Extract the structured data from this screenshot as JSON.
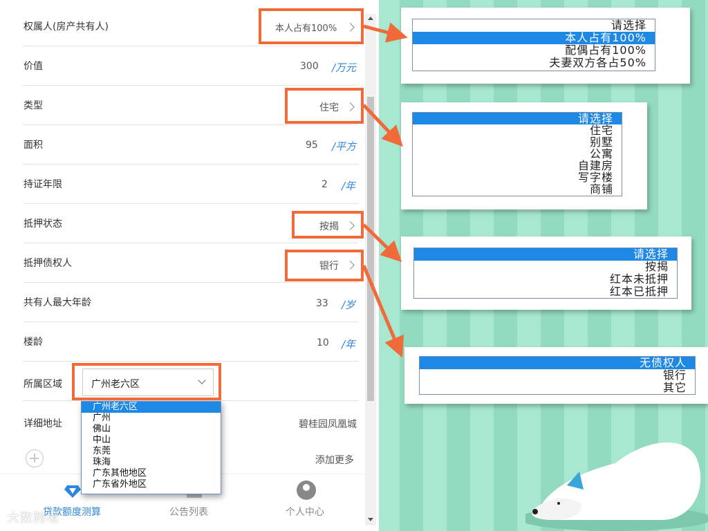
{
  "form": {
    "rows": [
      {
        "label": "权属人(房产共有人)",
        "value": "本人占有100%",
        "unit": "",
        "type": "select"
      },
      {
        "label": "价值",
        "value": "300",
        "unit": "/万元",
        "type": "input"
      },
      {
        "label": "类型",
        "value": "住宅",
        "unit": "",
        "type": "select"
      },
      {
        "label": "面积",
        "value": "95",
        "unit": "/平方",
        "type": "input"
      },
      {
        "label": "持证年限",
        "value": "2",
        "unit": "/年",
        "type": "input"
      },
      {
        "label": "抵押状态",
        "value": "按揭",
        "unit": "",
        "type": "select"
      },
      {
        "label": "抵押债权人",
        "value": "银行",
        "unit": "",
        "type": "select"
      },
      {
        "label": "共有人最大年龄",
        "value": "33",
        "unit": "/岁",
        "type": "input"
      },
      {
        "label": "楼龄",
        "value": "10",
        "unit": "/年",
        "type": "input"
      },
      {
        "label": "所属区域",
        "value": "广州老六区",
        "unit": "",
        "type": "dropdown"
      },
      {
        "label": "详细地址",
        "value": "碧桂园凤凰城",
        "unit": "",
        "type": "input"
      }
    ],
    "region_options": [
      "广州老六区",
      "广州",
      "佛山",
      "中山",
      "东莞",
      "珠海",
      "广东其他地区",
      "广东省外地区"
    ],
    "add_more": "添加更多"
  },
  "tabbar": {
    "loan": "贷款额度测算",
    "notice": "公告列表",
    "me": "个人中心"
  },
  "panels": {
    "owner": [
      "请选择",
      "本人占有100%",
      "配偶占有100%",
      "夫妻双方各占50%"
    ],
    "type": [
      "请选择",
      "住宅",
      "别墅",
      "公寓",
      "自建房",
      "写字楼",
      "商铺"
    ],
    "mortgage_status": [
      "请选择",
      "按揭",
      "红本未抵押",
      "红本已抵押"
    ],
    "creditor": [
      "无债权人",
      "银行",
      "其它"
    ]
  },
  "watermark": "大数跨境",
  "colors": {
    "accent": "#2e86de",
    "highlight": "#f06a3a",
    "selected": "#1e88e5",
    "background": "#9ee3c9"
  }
}
